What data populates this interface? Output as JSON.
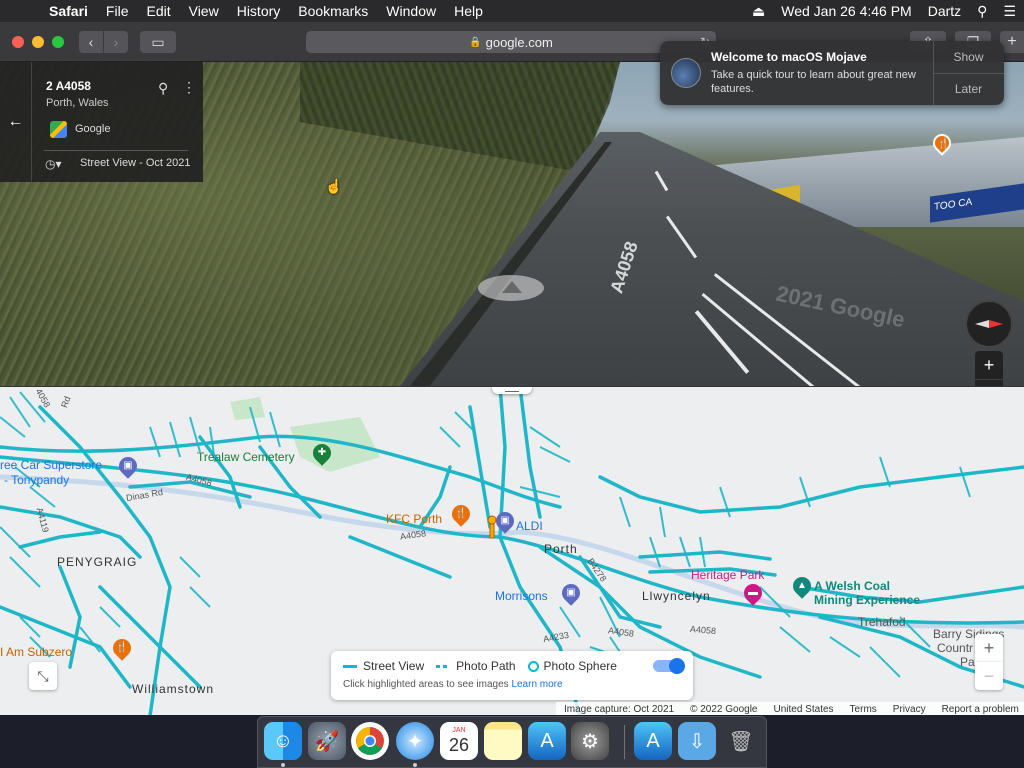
{
  "menubar": {
    "app": "Safari",
    "items": [
      "File",
      "Edit",
      "View",
      "History",
      "Bookmarks",
      "Window",
      "Help"
    ],
    "clock": "Wed Jan 26  4:46 PM",
    "user": "Dartz"
  },
  "browser": {
    "url": "google.com"
  },
  "notification": {
    "title": "Welcome to macOS Mojave",
    "body": "Take a quick tour to learn about great new features.",
    "show_label": "Show",
    "later_label": "Later"
  },
  "streetview": {
    "place_title": "2 A4058",
    "place_sub": "Porth, Wales",
    "provider": "Google",
    "capture_label": "Street View - Oct 2021",
    "road_marking": "A4058",
    "watermark": "2021 Google",
    "sign_text": "TOO CA"
  },
  "map": {
    "labels": {
      "superstore": "ree Car Superstore",
      "tonypandy": "- Tonypandy",
      "cemetery": "Trealaw Cemetery",
      "dinas_rd": "Dinas Rd",
      "a4058_1": "A4058",
      "a4058_2": "A4058",
      "a4058_3": "A4058",
      "a4119": "A4119",
      "kfc": "KFC Porth",
      "aldi": "ALDI",
      "porth": "Porth",
      "penygraig": "PENYGRAIG",
      "morrisons": "Morrisons",
      "llwyncelyn": "Llwyncelyn",
      "heritage": "Heritage Park",
      "welsh_coal_1": "A Welsh Coal",
      "welsh_coal_2": "Mining Experience",
      "trehafod": "Trehafod",
      "barry_1": "Barry Sidings",
      "barry_2": "Countr",
      "barry_3": "Pa",
      "subzero": "I Am Subzero",
      "williamstown": "Williamstown",
      "a4233": "A4233",
      "b4278": "B4278",
      "a4058_4": "A4058",
      "rd_top": "4058",
      "rd_top2": "Rd"
    },
    "legend": {
      "street_view": "Street View",
      "photo_path": "Photo Path",
      "photo_sphere": "Photo Sphere",
      "hint": "Click highlighted areas to see images",
      "learn_more": "Learn more"
    },
    "attribution": {
      "capture": "Image capture: Oct 2021",
      "copyright": "© 2022 Google",
      "region": "United States",
      "terms": "Terms",
      "privacy": "Privacy",
      "report": "Report a problem"
    },
    "colors": {
      "coverage": "#00bcd4",
      "background": "#eceeef"
    }
  },
  "dock": {
    "calendar_month": "JAN",
    "calendar_day": "26"
  }
}
